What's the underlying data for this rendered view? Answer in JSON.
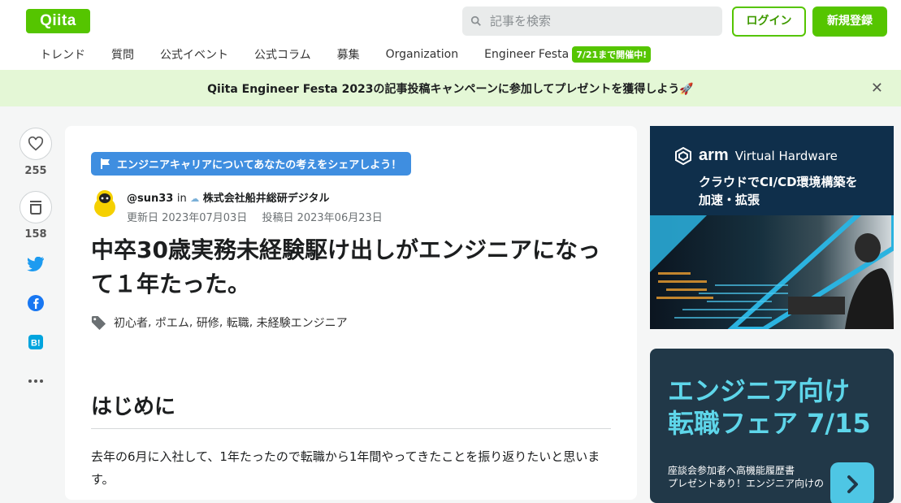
{
  "header": {
    "logo": "Qiita",
    "search_placeholder": "記事を検索",
    "login": "ログイン",
    "signup": "新規登録"
  },
  "nav": {
    "items": [
      "トレンド",
      "質問",
      "公式イベント",
      "公式コラム",
      "募集",
      "Organization",
      "Engineer Festa"
    ],
    "festa_badge": "7/21まで開催中!"
  },
  "banner": {
    "text": "Qiita Engineer Festa 2023の記事投稿キャンペーンに参加してプレゼントを獲得しよう🚀"
  },
  "side": {
    "likes": "255",
    "stocks": "158"
  },
  "article": {
    "campaign": "エンジニアキャリアについてあなたの考えをシェアしよう！",
    "author": "@sun33",
    "in_label": "in",
    "org": "株式会社船井総研デジタル",
    "updated": "更新日 2023年07月03日",
    "posted": "投稿日 2023年06月23日",
    "title": "中卒30歳実務未経験駆け出しがエンジニアになって１年たった。",
    "tags": [
      "初心者",
      "ポエム",
      "研修",
      "転職",
      "未経験エンジニア"
    ],
    "heading": "はじめに",
    "paragraph": "去年の6月に入社して、1年たったので転職から1年間やってきたことを振り返りたいと思います。"
  },
  "ads": {
    "ad1_brand": "arm",
    "ad1_brand_sub": "Virtual Hardware",
    "ad1_headline_1": "クラウドでCI/CD環境構築を",
    "ad1_headline_2": "加速・拡張",
    "ad2_line1": "エンジニア向け",
    "ad2_line2": "転職フェア 7/15",
    "ad2_small_1": "座談会参加者へ高機能履歴書",
    "ad2_small_2": "プレゼントあり！エンジニア向けの"
  }
}
